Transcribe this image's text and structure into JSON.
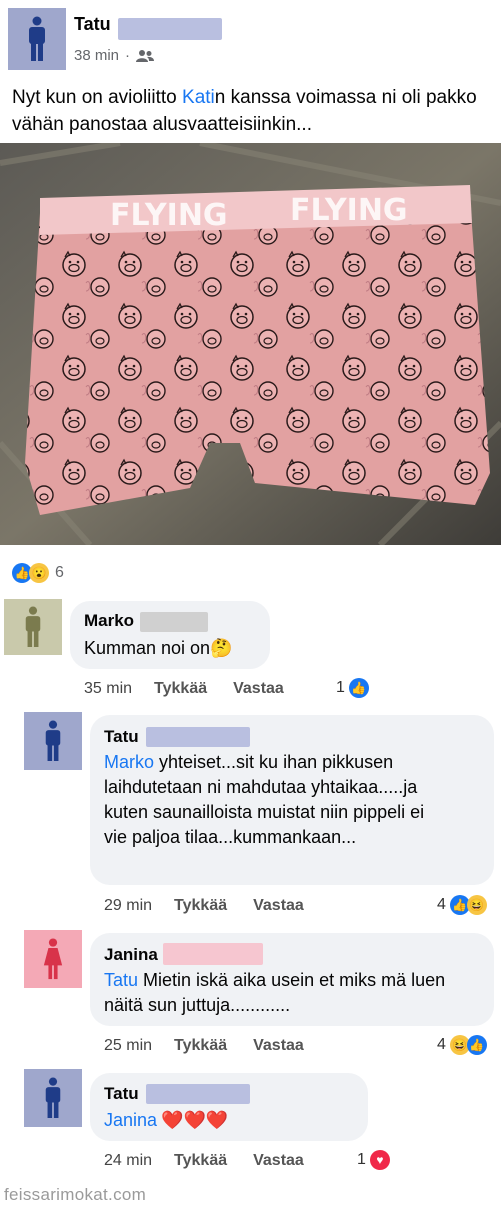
{
  "post": {
    "author": "Tatu",
    "time": "38 min",
    "separator": "·",
    "audience_icon": "friends-icon",
    "text_part1": "Nyt kun on avioliitto ",
    "mention": "Kati",
    "text_part2": "n kanssa voimassa ni oli pakko vähän panostaa alusvaatteisiinkin...",
    "photo_text": "FLYING",
    "reactions_count": "6",
    "reaction_icons": [
      "like-icon",
      "wow-icon"
    ]
  },
  "comments": [
    {
      "author": "Marko",
      "text": "Kumman noi on",
      "text_emoji": "🤔",
      "time": "35 min",
      "like_label": "Tykkää",
      "reply_label": "Vastaa",
      "reaction_count": "1",
      "reaction_icons": [
        "like-icon"
      ],
      "avatar_color": "#c9c9ab",
      "figure_color": "#7b7b4e"
    },
    {
      "author": "Tatu",
      "mention": "Marko",
      "text": " yhteiset...sit ku ihan pikkusen laihdutetaan ni mahdutaa yhtaikaa.....ja kuten saunailloista muistat niin pippeli ei vie paljoa tilaa...kummankaan...",
      "time": "29 min",
      "like_label": "Tykkää",
      "reply_label": "Vastaa",
      "reaction_count": "4",
      "reaction_icons": [
        "like-icon",
        "haha-icon"
      ],
      "avatar_color": "#9fa7cc",
      "figure_color": "#1f3c88"
    },
    {
      "author": "Janina",
      "mention": "Tatu",
      "text": " Mietin iskä aika usein et miks mä luen näitä sun juttuja............",
      "time": "25 min",
      "like_label": "Tykkää",
      "reply_label": "Vastaa",
      "reaction_count": "4",
      "reaction_icons": [
        "haha-icon",
        "like-icon"
      ],
      "avatar_color": "#f4a9b6",
      "figure_color": "#d8334a"
    },
    {
      "author": "Tatu",
      "mention": "Janina",
      "text": "",
      "text_emoji": "❤️❤️❤️",
      "time": "24 min",
      "like_label": "Tykkää",
      "reply_label": "Vastaa",
      "reaction_count": "1",
      "reaction_icons": [
        "love-icon"
      ],
      "avatar_color": "#9fa7cc",
      "figure_color": "#1f3c88"
    }
  ],
  "watermark": "feissarimokat.com",
  "colors": {
    "link": "#1877f2",
    "bubble": "#f0f2f5",
    "redact_blue": "#b9bfe0",
    "redact_grey": "#d0d0d0",
    "redact_pink": "#f6c6d0"
  }
}
